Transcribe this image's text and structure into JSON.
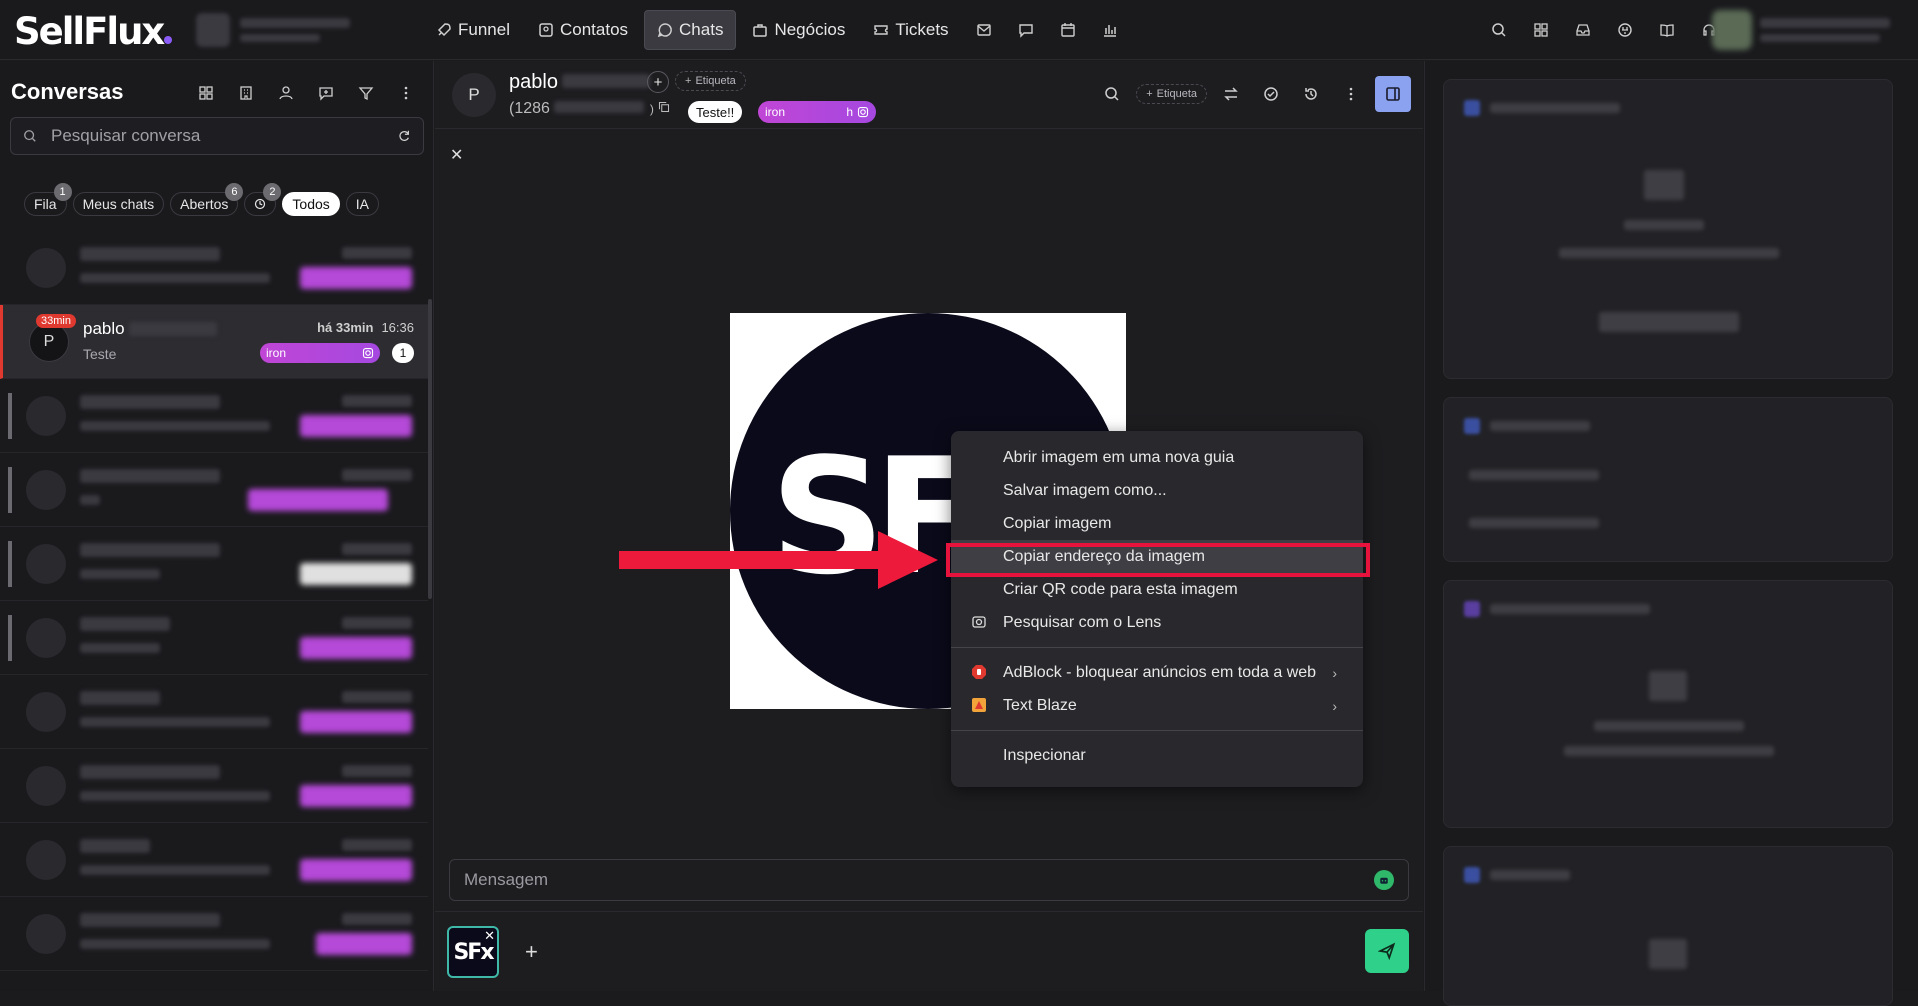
{
  "app": {
    "brand": "SellFlux"
  },
  "nav": {
    "items": [
      {
        "label": "Funnel",
        "icon": "rocket-icon"
      },
      {
        "label": "Contatos",
        "icon": "contacts-icon"
      },
      {
        "label": "Chats",
        "icon": "chat-bubble-icon",
        "active": true
      },
      {
        "label": "Negócios",
        "icon": "briefcase-icon"
      },
      {
        "label": "Tickets",
        "icon": "ticket-icon"
      }
    ]
  },
  "sidebar": {
    "title": "Conversas",
    "search_placeholder": "Pesquisar conversa",
    "filters": [
      {
        "label": "Fila",
        "count": "1"
      },
      {
        "label": "Meus chats",
        "count": ""
      },
      {
        "label": "Abertos",
        "count": "6"
      },
      {
        "label": "",
        "count": "2",
        "icon": "clock-icon"
      },
      {
        "label": "Todos",
        "count": "",
        "active": true
      },
      {
        "label": "IA",
        "count": ""
      }
    ],
    "selected": {
      "avatar": "P",
      "badge": "33min",
      "name": "pablo",
      "preview": "Teste",
      "ago": "há 33min",
      "time": "16:36",
      "tag": "iron",
      "unread": "1"
    }
  },
  "chat": {
    "avatar": "P",
    "name": "pablo",
    "phone": "(1286",
    "etiqueta": "Etiqueta",
    "tag_white": "Teste!!",
    "tag_ig_left": "iron",
    "tag_ig_right": "h",
    "message_placeholder": "Mensagem",
    "preview_logo": "SFx"
  },
  "context_menu": {
    "items": [
      "Abrir imagem em uma nova guia",
      "Salvar imagem como...",
      "Copiar imagem",
      "Copiar endereço da imagem",
      "Criar QR code para esta imagem",
      "Pesquisar com o Lens",
      "AdBlock - bloquear anúncios em toda a web",
      "Text Blaze",
      "Inspecionar"
    ],
    "highlighted": "Copiar endereço da imagem"
  },
  "colors": {
    "accent_red": "#ee1a3c",
    "send_green": "#2fd18a",
    "tag_purple": "#b549d8"
  }
}
